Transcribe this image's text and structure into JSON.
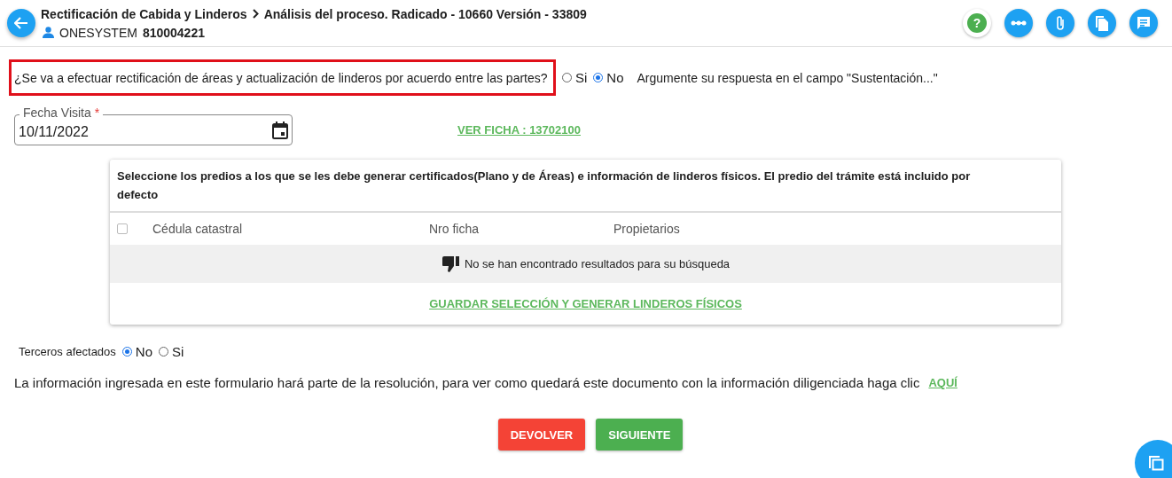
{
  "header": {
    "breadcrumb": [
      "Rectificación de Cabida y Linderos",
      "Análisis del proceso. Radicado - 10660 Versión - 33809"
    ],
    "user": "ONESYSTEM",
    "user_id": "810004221",
    "actions": [
      {
        "kind": "help",
        "label": "?"
      },
      {
        "kind": "flow"
      },
      {
        "kind": "attach"
      },
      {
        "kind": "copy"
      },
      {
        "kind": "comments"
      }
    ]
  },
  "question": {
    "text": "¿Se va a efectuar rectificación de áreas y actualización de linderos por acuerdo entre las partes?",
    "options": [
      {
        "label": "Si",
        "selected": false
      },
      {
        "label": "No",
        "selected": true
      }
    ],
    "hint": "Argumente su respuesta en el campo \"Sustentación...\""
  },
  "date_field": {
    "label": "Fecha Visita",
    "required_mark": "*",
    "value": "10/11/2022"
  },
  "ficha_link": "VER FICHA : 13702100",
  "card": {
    "title": "Seleccione los predios a los que se les debe generar certificados(Plano y de Áreas) e información de linderos físicos. El predio del trámite está incluido por defecto",
    "select_all_checked": false,
    "columns": [
      "Cédula catastral",
      "Nro ficha",
      "Propietarios"
    ],
    "empty_message": "No se han encontrado resultados para su búsqueda",
    "action": "GUARDAR SELECCIÓN Y GENERAR LINDEROS FÍSICOS"
  },
  "terceros": {
    "label": "Terceros afectados",
    "options": [
      {
        "label": "No",
        "selected": true
      },
      {
        "label": "Si",
        "selected": false
      }
    ]
  },
  "info": {
    "text": "La información ingresada en este formulario hará parte de la resolución, para ver como quedará este documento con la información diligenciada haga clic",
    "link": "AQUÍ"
  },
  "buttons": [
    {
      "label": "DEVOLVER",
      "kind": "danger"
    },
    {
      "label": "SIGUIENTE",
      "kind": "success"
    }
  ]
}
